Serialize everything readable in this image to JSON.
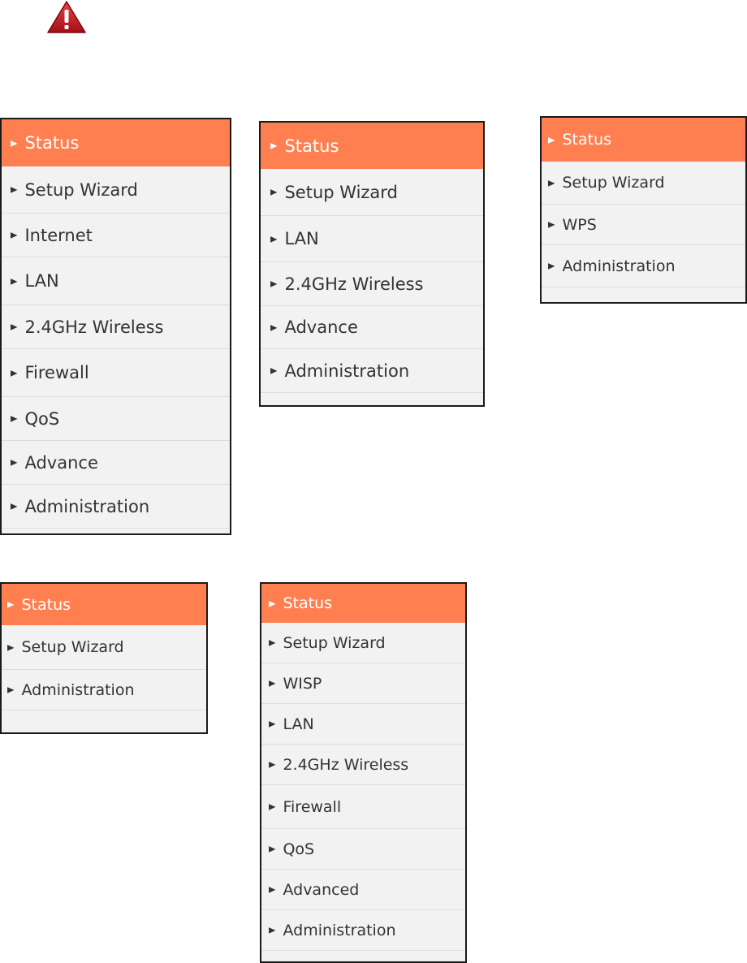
{
  "colors": {
    "accent": "#ff7f50",
    "item_bg": "#f2f2f2",
    "text": "#333333",
    "active_text": "#ffffff",
    "warning": "#c8101a"
  },
  "icons": {
    "warning": "warning-triangle-icon",
    "arrow": "triangle-right-icon"
  },
  "arrow_glyph": "▶",
  "menus": [
    {
      "items": [
        "Status",
        "Setup Wizard",
        "Internet",
        "LAN",
        "2.4GHz Wireless",
        "Firewall",
        "QoS",
        "Advance",
        "Administration"
      ],
      "active": 0
    },
    {
      "items": [
        "Status",
        "Setup Wizard",
        "LAN",
        "2.4GHz Wireless",
        "Advance",
        "Administration"
      ],
      "active": 0
    },
    {
      "items": [
        "Status",
        "Setup Wizard",
        "WPS",
        "Administration"
      ],
      "active": 0
    },
    {
      "items": [
        "Status",
        "Setup Wizard",
        "Administration"
      ],
      "active": 0
    },
    {
      "items": [
        "Status",
        "Setup Wizard",
        "WISP",
        "LAN",
        "2.4GHz Wireless",
        "Firewall",
        "QoS",
        "Advanced",
        "Administration"
      ],
      "active": 0
    }
  ]
}
